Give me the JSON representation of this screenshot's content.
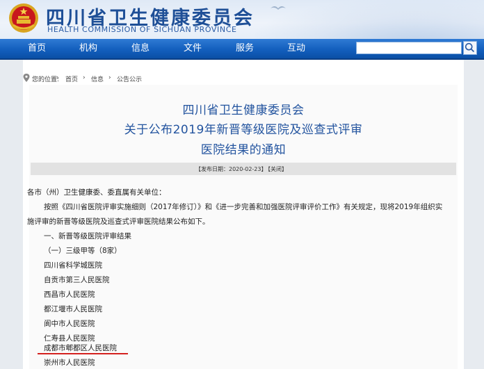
{
  "header": {
    "title": "四川省卫生健康委员会",
    "subtitle": "HEALTH COMMISSION OF SICHUAN PROVINCE"
  },
  "nav": {
    "items": [
      "首页",
      "机构",
      "信息",
      "文件",
      "服务",
      "互动"
    ]
  },
  "search": {
    "value": ""
  },
  "breadcrumb": {
    "label": "您的位置:",
    "items": [
      "首页",
      "信息",
      "公告公示"
    ],
    "separator": "›"
  },
  "article": {
    "headline": [
      "四川省卫生健康委员会",
      "关于公布2019年新晋等级医院及巡查式评审",
      "医院结果的通知"
    ],
    "publish_date": "【发布日期：2020-02-23】",
    "close_label": "【关闭】",
    "salutation": "各市（州）卫生健康委、委直属有关单位：",
    "paragraph": [
      "按照《四川省医院评审实施细则（2017年修订）》和《进一步完善和加强医院评审评价工作》有关规定，现将2019年组织实",
      "施评审的新晋等级医院及巡查式评审医院结果公布如下。"
    ],
    "section_heading": "一、新晋等级医院评审结果",
    "subsection_heading": "（一）三级甲等（8家）",
    "hospitals": [
      "四川省科学城医院",
      "自贡市第三人民医院",
      "西昌市人民医院",
      "都江堰市人民医院",
      "阆中市人民医院",
      "仁寿县人民医院",
      "成都市郫都区人民医院",
      "崇州市人民医院"
    ]
  },
  "colors": {
    "brand_blue": "#1e4f97",
    "nav_blue": "#135fbd",
    "headline_blue": "#23549f",
    "highlight_red": "#d4201e"
  }
}
